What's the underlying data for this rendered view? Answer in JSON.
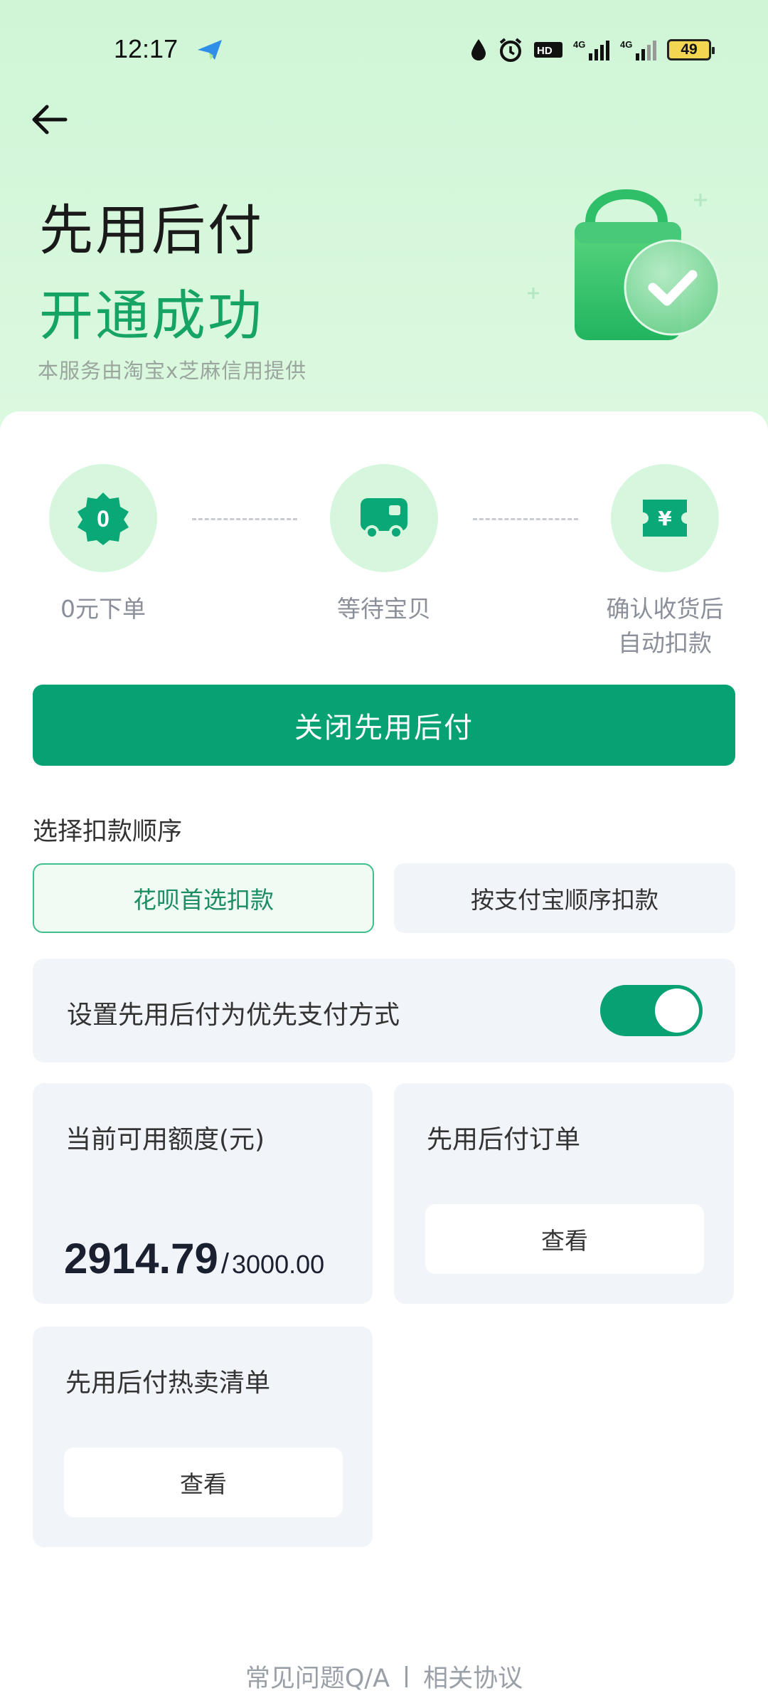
{
  "status_bar": {
    "time": "12:17",
    "battery": "49",
    "icons": [
      "app-plane-icon",
      "water-drop-icon",
      "alarm-icon",
      "hd-icon",
      "signal-4g-icon",
      "signal-4g-icon",
      "battery-icon"
    ]
  },
  "header": {
    "title": "先用后付",
    "subtitle": "开通成功",
    "provider": "本服务由淘宝x芝麻信用提供"
  },
  "steps": [
    {
      "label": "0元下单",
      "icon": "zero-badge-icon",
      "badge": "0"
    },
    {
      "label": "等待宝贝",
      "icon": "truck-icon"
    },
    {
      "label_line1": "确认收货后",
      "label_line2": "自动扣款",
      "icon": "yuan-ticket-icon",
      "badge": "¥"
    }
  ],
  "close_button": "关闭先用后付",
  "deduction": {
    "label": "选择扣款顺序",
    "options": [
      "花呗首选扣款",
      "按支付宝顺序扣款"
    ],
    "selected": "花呗首选扣款"
  },
  "preference": {
    "label": "设置先用后付为优先支付方式",
    "enabled": true
  },
  "quota": {
    "title": "当前可用额度(元)",
    "available": "2914.79",
    "separator": "/",
    "total": "3000.00"
  },
  "orders": {
    "title": "先用后付订单",
    "button": "查看"
  },
  "hot_list": {
    "title": "先用后付热卖清单",
    "button": "查看"
  },
  "footer": {
    "faq": "常见问题Q/A",
    "agreement": "相关协议"
  },
  "colors": {
    "accent": "#07a174",
    "success_text": "#16a464",
    "hero_bg": "#d5f7dc"
  }
}
